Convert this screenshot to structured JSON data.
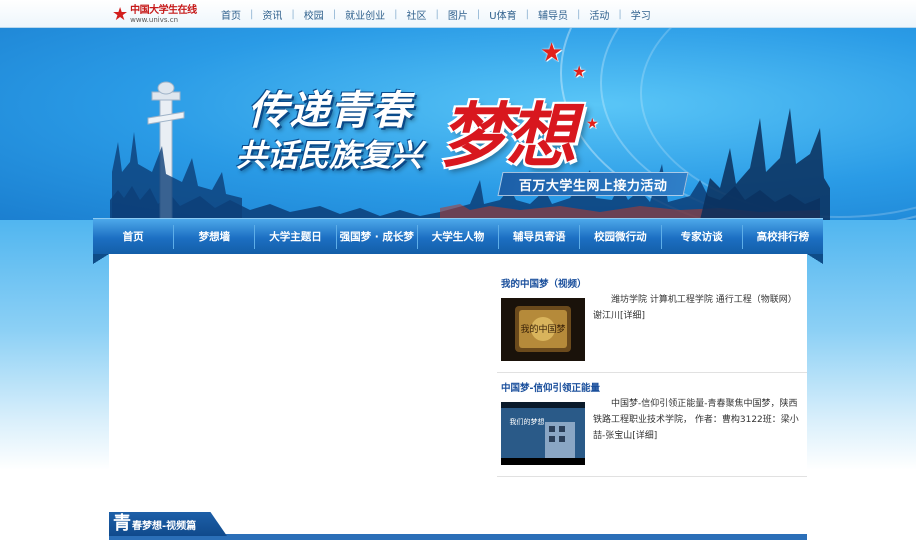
{
  "header": {
    "logo_name": "中国大学生在线",
    "logo_url": "www.univs.cn",
    "nav": [
      "首页",
      "资讯",
      "校园",
      "就业创业",
      "社区",
      "图片",
      "U体育",
      "辅导员",
      "活动",
      "学习"
    ]
  },
  "banner": {
    "title_line1": "传递青春",
    "title_line2": "共话民族复兴",
    "dream": "梦想",
    "subtitle": "百万大学生网上接力活动"
  },
  "main_nav": [
    "首页",
    "梦想墙",
    "大学主题日",
    "强国梦 · 成长梦",
    "大学生人物",
    "辅导员寄语",
    "校园微行动",
    "专家访谈",
    "高校排行榜"
  ],
  "videos": [
    {
      "title": "我的中国梦（视频）",
      "desc": "潍坊学院 计算机工程学院 通行工程（物联网） 谢江川[详细]",
      "thumb_text": "我的中国梦"
    },
    {
      "title": "中国梦-信仰引领正能量",
      "desc": "中国梦-信仰引领正能量-青春聚焦中国梦，陕西铁路工程职业技术学院， 作者：曹构3122班：梁小喆-张宝山[详细]",
      "thumb_text": "我们的梦想"
    }
  ],
  "section": {
    "big_char": "青",
    "label": "春梦想-视频篇"
  },
  "colors": {
    "brand_red": "#d8171e",
    "nav_blue": "#1c6fc2",
    "link_blue": "#1a4f9c"
  }
}
